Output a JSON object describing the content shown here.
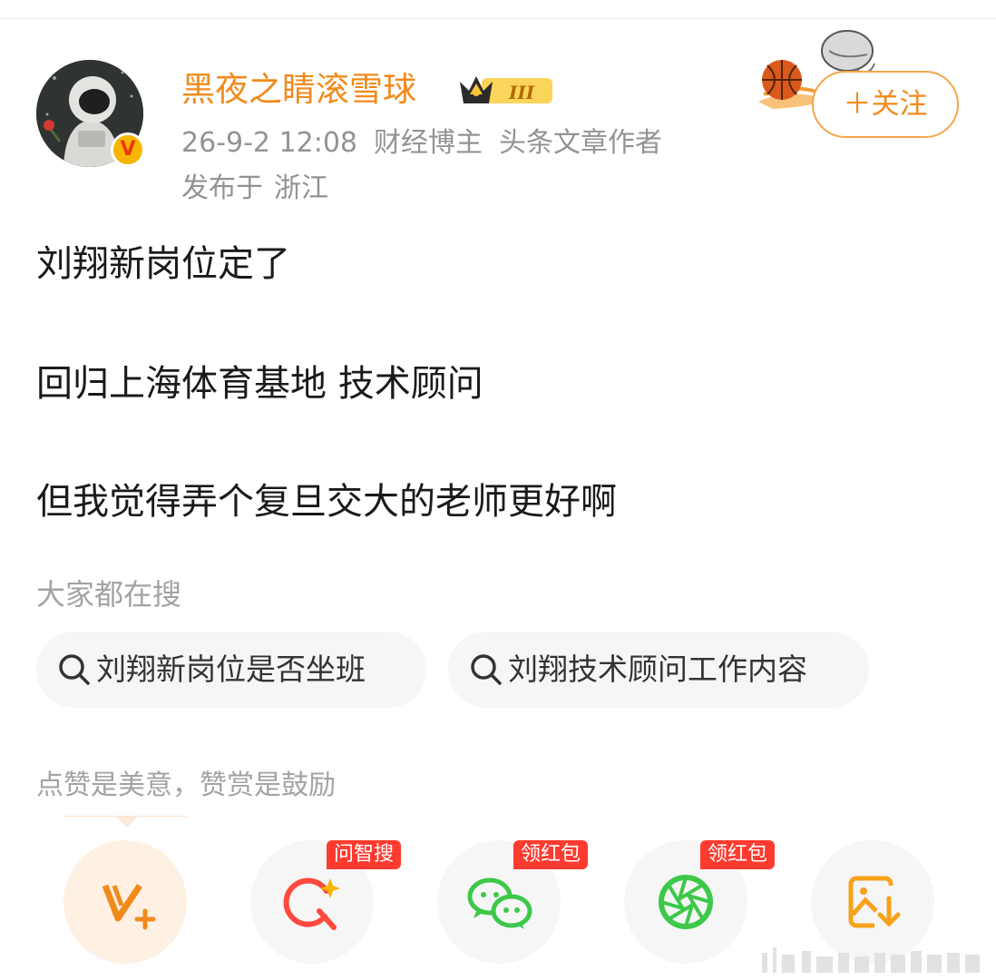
{
  "post": {
    "username": "黑夜之睛滚雪球",
    "level_badge": "III",
    "verified_mark": "V",
    "time": "26-9-2 12:08",
    "tags": [
      "财经博主",
      "头条文章作者"
    ],
    "location_label": "发布于",
    "location": "浙江",
    "follow_label": "＋关注",
    "content": [
      "刘翔新岗位定了",
      "回归上海体育基地  技术顾问",
      "但我觉得弄个复旦交大的老师更好啊"
    ]
  },
  "search": {
    "label": "大家都在搜",
    "chips": [
      "刘翔新岗位是否坐班",
      "刘翔技术顾问工作内容"
    ]
  },
  "reward": {
    "text": "点赞是美意，赞赏是鼓励"
  },
  "actions": {
    "items": [
      {
        "icon": "reward-v-plus-icon",
        "tag": ""
      },
      {
        "icon": "ai-search-icon",
        "tag": "问智搜"
      },
      {
        "icon": "wechat-icon",
        "tag": "领红包"
      },
      {
        "icon": "moments-icon",
        "tag": "领红包"
      },
      {
        "icon": "save-image-icon",
        "tag": ""
      }
    ]
  },
  "colors": {
    "accent": "#f28a1c",
    "follow_border": "#f5a54b",
    "red_tag": "#ff3b30",
    "wechat_green": "#3dc84a",
    "muted": "#939393"
  }
}
